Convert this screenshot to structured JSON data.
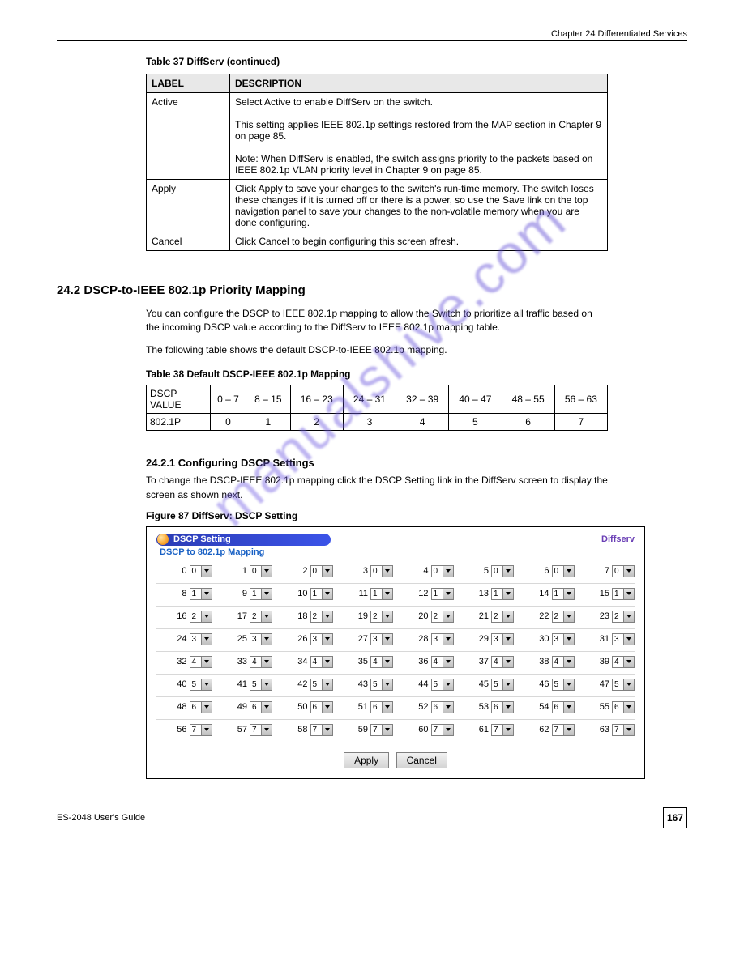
{
  "header": {
    "chapter_line": "Chapter 24 Differentiated Services"
  },
  "watermark": "manualshive.com",
  "table37": {
    "title": "Table 37   DiffServ (continued)",
    "header": [
      "LABEL",
      "DESCRIPTION"
    ],
    "rows": [
      [
        "Active",
        "Select Active to enable DiffServ on the switch.\n\nThis setting applies IEEE 802.1p settings restored from the MAP section in Chapter 9 on page 85.\n\nNote: When DiffServ is enabled, the switch assigns priority to the packets based on IEEE 802.1p VLAN priority level in Chapter 9 on page 85."
      ],
      [
        "Apply",
        "Click Apply to save your changes to the switch's run-time memory. The switch loses these changes if it is turned off or there is a power, so use the Save link on the top navigation panel to save your changes to the non-volatile memory when you are done configuring."
      ],
      [
        "Cancel",
        "Click Cancel to begin configuring this screen afresh."
      ]
    ]
  },
  "section241": {
    "heading": "24.2 DSCP-to-IEEE 802.1p Priority Mapping",
    "p1": "You can configure the DSCP to IEEE 802.1p mapping to allow the Switch to prioritize all traffic based on the incoming DSCP value according to the DiffServ to IEEE 802.1p mapping table.",
    "p2": "The following table shows the default DSCP-to-IEEE 802.1p mapping."
  },
  "table38": {
    "caption": "Table 38   Default DSCP-IEEE 802.1p Mapping",
    "header": [
      "DSCP VALUE",
      "0 – 7",
      "8 – 15",
      "16 – 23",
      "24 – 31",
      "32 – 39",
      "40 – 47",
      "48 – 55",
      "56 – 63"
    ],
    "row": [
      "802.1P",
      "0",
      "1",
      "2",
      "3",
      "4",
      "5",
      "6",
      "7"
    ]
  },
  "sub2411": {
    "heading": "24.2.1  Configuring DSCP Settings",
    "p1": "To change the DSCP-IEEE 802.1p mapping click the DSCP Setting link in the DiffServ screen to display the screen as shown next."
  },
  "figure87": {
    "caption": "Figure 87   DiffServ: DSCP Setting",
    "pill_label": "DSCP Setting",
    "link_label": "Diffserv",
    "sub_title": "DSCP to 802.1p Mapping",
    "buttons": {
      "apply": "Apply",
      "cancel": "Cancel"
    }
  },
  "chart_data": {
    "type": "table",
    "title": "DSCP to 802.1p Mapping",
    "columns": [
      "DSCP",
      "802.1p"
    ],
    "rows": [
      [
        0,
        0
      ],
      [
        1,
        0
      ],
      [
        2,
        0
      ],
      [
        3,
        0
      ],
      [
        4,
        0
      ],
      [
        5,
        0
      ],
      [
        6,
        0
      ],
      [
        7,
        0
      ],
      [
        8,
        1
      ],
      [
        9,
        1
      ],
      [
        10,
        1
      ],
      [
        11,
        1
      ],
      [
        12,
        1
      ],
      [
        13,
        1
      ],
      [
        14,
        1
      ],
      [
        15,
        1
      ],
      [
        16,
        2
      ],
      [
        17,
        2
      ],
      [
        18,
        2
      ],
      [
        19,
        2
      ],
      [
        20,
        2
      ],
      [
        21,
        2
      ],
      [
        22,
        2
      ],
      [
        23,
        2
      ],
      [
        24,
        3
      ],
      [
        25,
        3
      ],
      [
        26,
        3
      ],
      [
        27,
        3
      ],
      [
        28,
        3
      ],
      [
        29,
        3
      ],
      [
        30,
        3
      ],
      [
        31,
        3
      ],
      [
        32,
        4
      ],
      [
        33,
        4
      ],
      [
        34,
        4
      ],
      [
        35,
        4
      ],
      [
        36,
        4
      ],
      [
        37,
        4
      ],
      [
        38,
        4
      ],
      [
        39,
        4
      ],
      [
        40,
        5
      ],
      [
        41,
        5
      ],
      [
        42,
        5
      ],
      [
        43,
        5
      ],
      [
        44,
        5
      ],
      [
        45,
        5
      ],
      [
        46,
        5
      ],
      [
        47,
        5
      ],
      [
        48,
        6
      ],
      [
        49,
        6
      ],
      [
        50,
        6
      ],
      [
        51,
        6
      ],
      [
        52,
        6
      ],
      [
        53,
        6
      ],
      [
        54,
        6
      ],
      [
        55,
        6
      ],
      [
        56,
        7
      ],
      [
        57,
        7
      ],
      [
        58,
        7
      ],
      [
        59,
        7
      ],
      [
        60,
        7
      ],
      [
        61,
        7
      ],
      [
        62,
        7
      ],
      [
        63,
        7
      ]
    ]
  },
  "footer": {
    "left": "ES-2048 User's Guide",
    "page": "167"
  }
}
